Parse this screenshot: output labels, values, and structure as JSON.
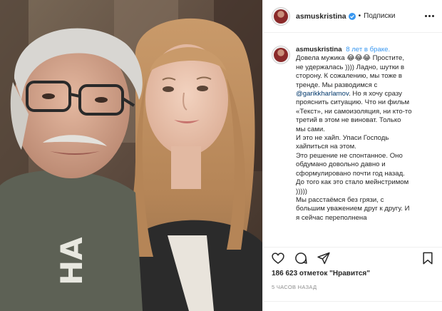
{
  "header": {
    "username": "asmuskristina",
    "separator": "•",
    "follow_label": "Подписки"
  },
  "caption": {
    "username": "asmuskristina",
    "line_intro": "8 лет в браке.",
    "line_1": "Довела мужика 😂😂😂 Простите,",
    "line_2": "не удержалась )))) Ладно, шутки в",
    "line_3": "сторону. К сожалению, мы тоже в",
    "line_4": "тренде. Мы разводимся с",
    "mention": "@garikkharlamov",
    "line_5": ". Но я хочу сразу",
    "line_6": "прояснить ситуацию. Что ни фильм",
    "line_7": "«Текст», ни самоизоляция, ни кто-то",
    "line_8": "третий в этом не виноват. Только",
    "line_9": "мы сами.",
    "line_10": "И это не хайп. Упаси Господь",
    "line_11": "хайпиться на этом.",
    "line_12": "Это решение не спонтанное. Оно",
    "line_13": "обдумано довольно давно и",
    "line_14": "сформулировано почти год назад.",
    "line_15": "До того как это стало мейнстримом",
    "line_16": ")))))",
    "line_17": "Мы расстаёмся без грязи, с",
    "line_18": "большим уважением друг к другу. И",
    "line_19": "я сейчас переполнена"
  },
  "stats": {
    "likes": "186 623 отметок \"Нравится\"",
    "time_ago": "5 ЧАСОВ НАЗАД"
  },
  "icons": {
    "like": "heart-icon",
    "comment": "comment-icon",
    "share": "share-icon",
    "save": "bookmark-icon",
    "more": "more-options-icon",
    "verified": "verified-badge-icon"
  },
  "colors": {
    "accent": "#3897f0",
    "mention": "#00376b",
    "text": "#262626",
    "muted": "#8e8e8e",
    "border": "#efefef"
  },
  "photo": {
    "shirt_text": "HA"
  }
}
